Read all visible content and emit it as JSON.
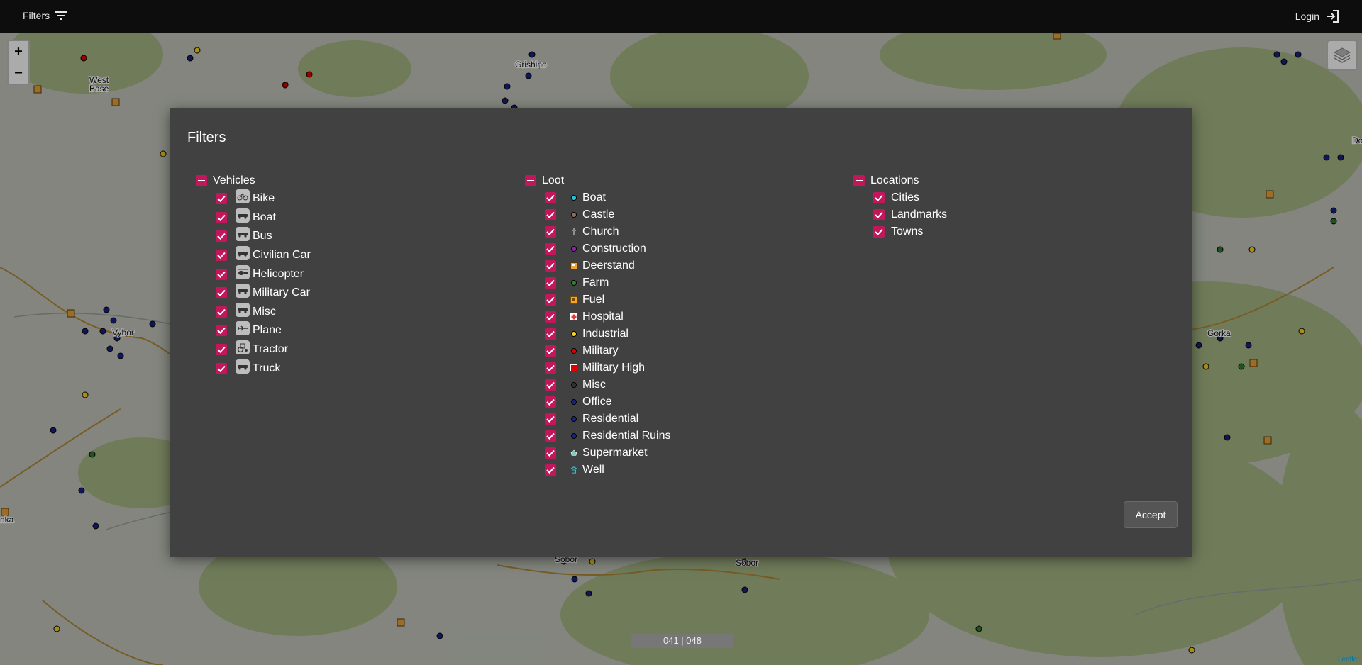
{
  "topbar": {
    "filters_label": "Filters",
    "login_label": "Login"
  },
  "map": {
    "zoom_in": "+",
    "zoom_out": "−",
    "coords": "041 | 048",
    "attribution": "Leaflet",
    "labels": [
      "West Base",
      "Grishino",
      "Vybor",
      "Gorka",
      "Sobor",
      "Sobor",
      "Do",
      "nka"
    ]
  },
  "modal": {
    "title": "Filters",
    "accept_label": "Accept",
    "vehicles": {
      "label": "Vehicles",
      "items": [
        {
          "label": "Bike",
          "icon": "bike-icon"
        },
        {
          "label": "Boat",
          "icon": "boat-icon"
        },
        {
          "label": "Bus",
          "icon": "bus-icon"
        },
        {
          "label": "Civilian Car",
          "icon": "car-icon"
        },
        {
          "label": "Helicopter",
          "icon": "helicopter-icon"
        },
        {
          "label": "Military Car",
          "icon": "military-car-icon"
        },
        {
          "label": "Misc",
          "icon": "misc-vehicle-icon"
        },
        {
          "label": "Plane",
          "icon": "plane-icon"
        },
        {
          "label": "Tractor",
          "icon": "tractor-icon"
        },
        {
          "label": "Truck",
          "icon": "truck-icon"
        }
      ]
    },
    "loot": {
      "label": "Loot",
      "items": [
        {
          "label": "Boat",
          "icon": "dot-icon",
          "color": "#26c6da"
        },
        {
          "label": "Castle",
          "icon": "dot-icon",
          "color": "#8d6e63"
        },
        {
          "label": "Church",
          "icon": "cross-icon",
          "color": "#ffffff"
        },
        {
          "label": "Construction",
          "icon": "dot-icon",
          "color": "#8e24aa"
        },
        {
          "label": "Deerstand",
          "icon": "deerstand-icon",
          "color": "#e8a33a"
        },
        {
          "label": "Farm",
          "icon": "dot-icon",
          "color": "#2e7d32"
        },
        {
          "label": "Fuel",
          "icon": "fuel-icon",
          "color": "#f5a623"
        },
        {
          "label": "Hospital",
          "icon": "hospital-icon",
          "color": "#e53935"
        },
        {
          "label": "Industrial",
          "icon": "dot-icon",
          "color": "#f9d423"
        },
        {
          "label": "Military",
          "icon": "dot-icon",
          "color": "#e00000"
        },
        {
          "label": "Military High",
          "icon": "military-high-icon",
          "color": "#e00000"
        },
        {
          "label": "Misc",
          "icon": "dot-icon",
          "color": "#333333"
        },
        {
          "label": "Office",
          "icon": "dot-icon",
          "color": "#1a237e"
        },
        {
          "label": "Residential",
          "icon": "dot-icon",
          "color": "#1a237e"
        },
        {
          "label": "Residential Ruins",
          "icon": "dot-icon",
          "color": "#1a237e"
        },
        {
          "label": "Supermarket",
          "icon": "basket-icon",
          "color": "#80cbc4"
        },
        {
          "label": "Well",
          "icon": "well-icon",
          "color": "#26c6da"
        }
      ]
    },
    "locations": {
      "label": "Locations",
      "items": [
        {
          "label": "Cities"
        },
        {
          "label": "Landmarks"
        },
        {
          "label": "Towns"
        }
      ]
    }
  }
}
